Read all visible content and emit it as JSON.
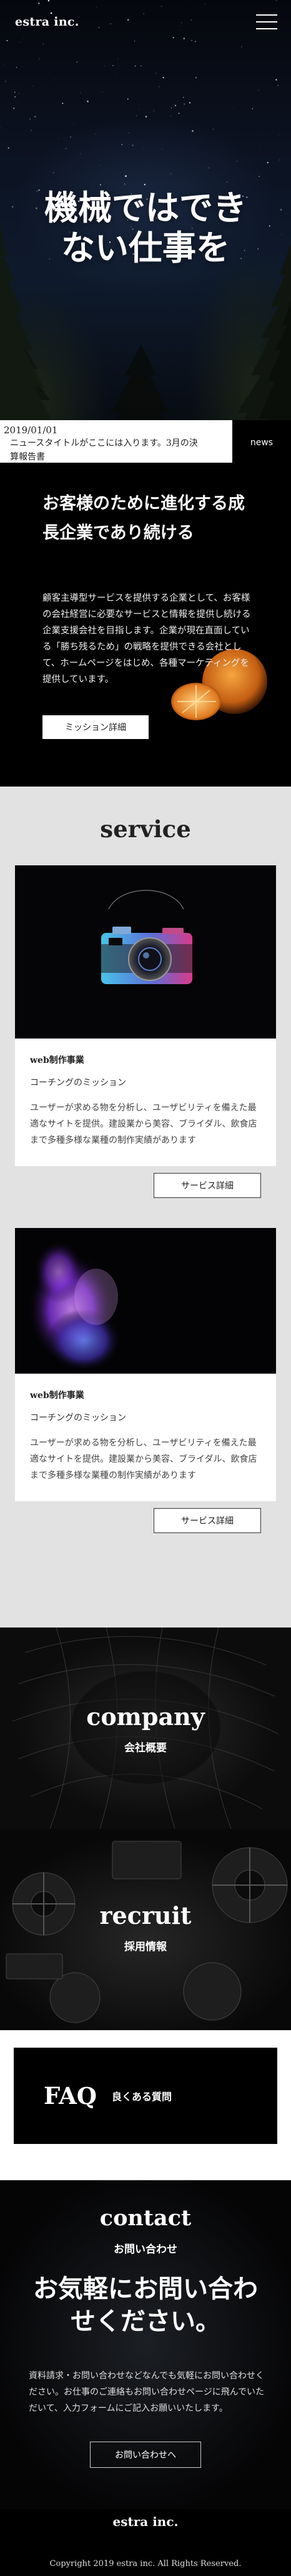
{
  "header": {
    "logo": "estra inc."
  },
  "hero": {
    "title_line1": "機械ではでき",
    "title_line2": "ない仕事を"
  },
  "news": {
    "date": "2019/01/01",
    "text_line1": "ニュースタイトルがここには入ります。3月の決",
    "text_line2": "算報告書",
    "label": "news"
  },
  "about": {
    "heading": "お客様のために進化する成長企業であり続ける",
    "body": "顧客主導型サービスを提供する企業として、お客様の会社経営に必要なサービスと情報を提供し続ける企業支援会社を目指します。企業が現在直面している「勝ち残るため」の戦略を提供できる会社として、ホームページをはじめ、各種マーケティングを提供しています。",
    "button": "ミッション詳細"
  },
  "service": {
    "title": "service",
    "cards": [
      {
        "tag": "web制作事業",
        "subtitle": "コーチングのミッション",
        "desc": "ユーザーが求める物を分析し、ユーザビリティを備えた最適なサイトを提供。建設業から美容、ブライダル、飲食店まで多種多様な業種の制作実績があります",
        "button": "サービス詳細"
      },
      {
        "tag": "web制作事業",
        "subtitle": "コーチングのミッション",
        "desc": "ユーザーが求める物を分析し、ユーザビリティを備えた最適なサイトを提供。建設業から美容、ブライダル、飲食店まで多種多様な業種の制作実績があります",
        "button": "サービス詳細"
      }
    ]
  },
  "company": {
    "title": "company",
    "subtitle": "会社概要"
  },
  "recruit": {
    "title": "recruit",
    "subtitle": "採用情報"
  },
  "faq": {
    "title": "FAQ",
    "subtitle": "良くある質問"
  },
  "contact": {
    "title": "contact",
    "subtitle": "お問い合わせ",
    "big_line1": "お気軽にお問い合わ",
    "big_line2": "せください。",
    "body": "資料請求・お問い合わせなどなんでも気軽にお問い合わせください。お仕事のご連絡もお問い合わせページに飛んでいただいて、入力フォームにご記入お願いいたします。",
    "button": "お問い合わせへ"
  },
  "footer": {
    "logo": "estra inc.",
    "copyright": "Copyright 2019 estra inc. All Rights Reserved."
  }
}
